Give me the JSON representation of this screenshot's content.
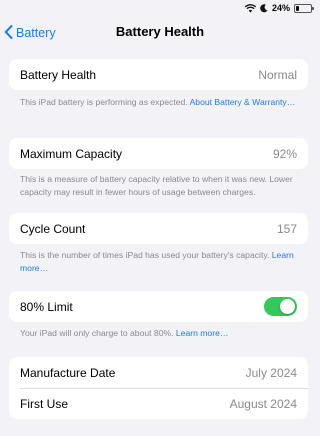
{
  "status_bar": {
    "battery_percent": "24%",
    "battery_level": 0.24
  },
  "nav": {
    "back_label": "Battery",
    "title": "Battery Health"
  },
  "battery_health": {
    "label": "Battery Health",
    "value": "Normal",
    "note": "This iPad battery is performing as expected. ",
    "link": "About Battery & Warranty…"
  },
  "maximum_capacity": {
    "label": "Maximum Capacity",
    "value": "92%",
    "note": "This is a measure of battery capacity relative to when it was new. Lower capacity may result in fewer hours of usage between charges."
  },
  "cycle_count": {
    "label": "Cycle Count",
    "value": "157",
    "note": "This is the number of times iPad has used your battery's capacity. ",
    "link": "Learn more…"
  },
  "limit": {
    "label": "80% Limit",
    "enabled": true,
    "note": "Your iPad will only charge to about 80%. ",
    "link": "Learn more…"
  },
  "dates": {
    "manufacture_label": "Manufacture Date",
    "manufacture_value": "July 2024",
    "first_use_label": "First Use",
    "first_use_value": "August 2024"
  },
  "colors": {
    "accent": "#1a7cf5",
    "toggle_on": "#34c759"
  }
}
